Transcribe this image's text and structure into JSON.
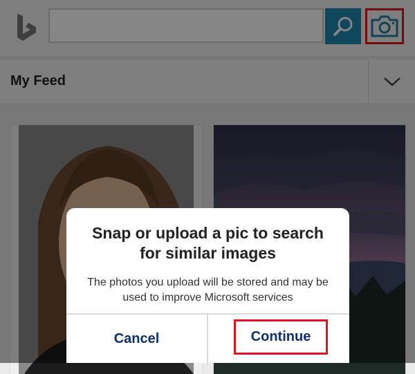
{
  "header": {
    "logo_icon": "bing-logo",
    "search": {
      "value": "",
      "placeholder": ""
    },
    "search_button_icon": "search-icon",
    "camera_button_icon": "camera-icon",
    "accent_color": "#1e8bb3",
    "highlight_color": "#e0141e"
  },
  "feed": {
    "title": "My Feed",
    "toggle_icon": "chevron-down-icon"
  },
  "dialog": {
    "title": "Snap or upload a pic to search for similar images",
    "message": "The photos you upload will be stored and may be used to improve Microsoft services",
    "cancel_label": "Cancel",
    "continue_label": "Continue",
    "button_color": "#0c2f6e"
  }
}
